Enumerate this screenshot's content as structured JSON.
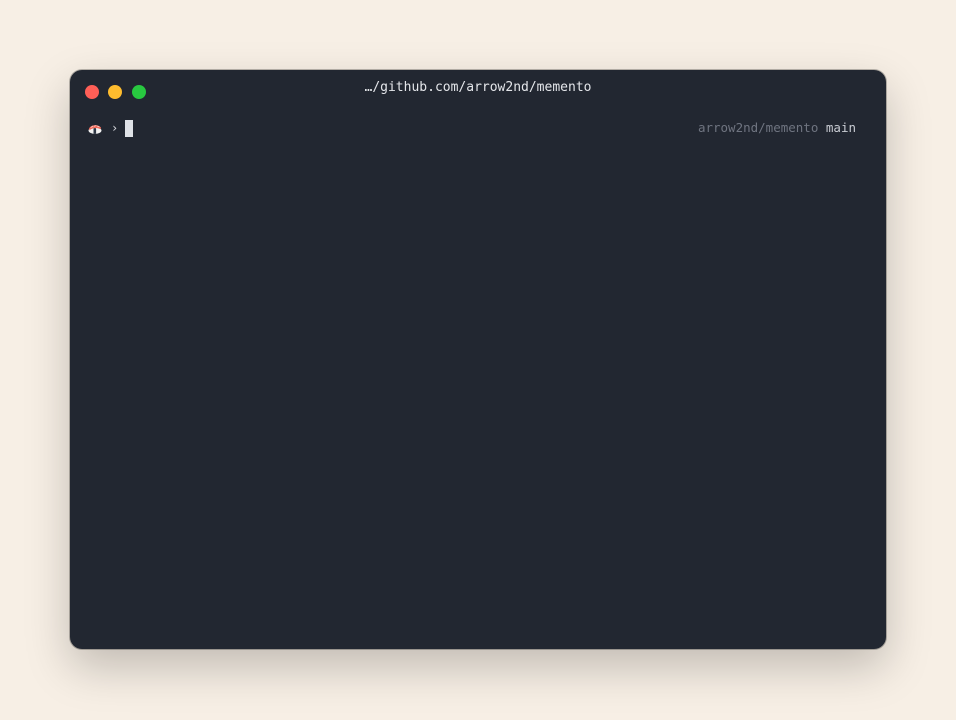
{
  "window": {
    "title": "…/github.com/arrow2nd/memento",
    "buttons": [
      {
        "name": "close",
        "color": "#ff5f57"
      },
      {
        "name": "minimize",
        "color": "#febc2e"
      },
      {
        "name": "maximize",
        "color": "#28c840"
      }
    ]
  },
  "prompt": {
    "icon": "sushi-icon",
    "symbol": "›",
    "repo": "arrow2nd/memento",
    "branch": "main"
  },
  "colors": {
    "background": "#f7efe5",
    "terminal": "#222731",
    "text": "#e4e6ea",
    "muted": "#6f7480"
  }
}
